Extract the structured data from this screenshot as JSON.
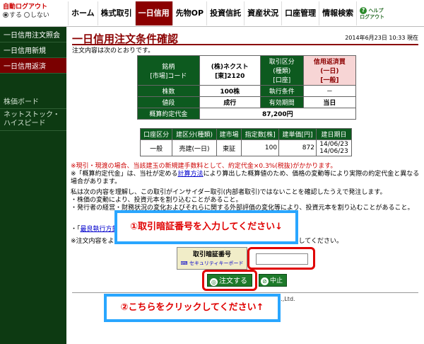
{
  "header": {
    "auto_logout_label": "自動ログアウト",
    "auto_logout_on": "する",
    "auto_logout_off": "しない",
    "nav": [
      "ホーム",
      "株式取引",
      "一日信用",
      "先物OP",
      "投資信託",
      "資産状況",
      "口座管理",
      "情報検索"
    ],
    "help_label": "ヘルプ",
    "logout_label": "ログアウト"
  },
  "sidebar": {
    "items": [
      "一日信用注文照会",
      "一日信用新規",
      "一日信用返済",
      "株価ボード",
      "ネットストック・ハイスピード"
    ]
  },
  "page": {
    "title": "一日信用注文条件確認",
    "timestamp": "2014年6月23日 10:33 現在",
    "intro": "注文内容は次のとおりです。"
  },
  "order": {
    "stock_label_1": "銘柄",
    "stock_label_2": "[市場]コード",
    "stock_name": "(株)ネクスト",
    "stock_market_code": "[東]2120",
    "type_label_1": "取引区分",
    "type_label_2": "(種類)",
    "type_label_3": "[口座]",
    "type_value_1": "信用返済買",
    "type_value_2": "(一日)",
    "type_value_3": "[一般]",
    "qty_label": "株数",
    "qty_value": "100株",
    "exec_label": "執行条件",
    "exec_value": "－",
    "price_label": "値段",
    "price_value": "成行",
    "validity_label": "有効期間",
    "validity_value": "当日",
    "estimate_label": "概算約定代金",
    "estimate_value": "87,200円"
  },
  "exec_table": {
    "headers": [
      "口座区分",
      "建区分(種類)",
      "建市場",
      "指定数[株]",
      "建単価[円]",
      "建日期日"
    ],
    "row": [
      "一般",
      "売建(一日)",
      "東証",
      "100",
      "872",
      "14/06/23",
      "14/06/23"
    ]
  },
  "notes": {
    "line1": "※現引・現渡の場合、当該建玉の新規建手数料として、約定代金×0.3%(税抜)がかかります。",
    "line2_a": "※「概算約定代金」は、当社が定める",
    "line2_link": "計算方法",
    "line2_b": "により算出した概算値のため、価格の変動等により実際の約定代金と異なる場合があります。"
  },
  "para": {
    "line1": "私は次の内容を理解し、この取引がインサイダー取引(内部者取引)ではないことを確認したうえで発注します。",
    "line2": "・株価の変動により、投資元本を割り込むことがあること。",
    "line3": "・発行者の経営・財務状況の変化およびそれらに関する外部評価の変化等により、投資元本を割り込むことがあること。",
    "link_prefix": "・「",
    "link_text": "最良執行方針"
  },
  "confirm_note": "※注文内容をよくご確認のうえ、取引暗証番号を入力し「注文する」ボタンを押してください。",
  "pin": {
    "label": "取引暗証番号",
    "keyboard_link": "セキュリティキーボード",
    "value": ""
  },
  "buttons": {
    "order": "注文する",
    "cancel": "中止"
  },
  "copyright": "Matsui Securities Co.,Ltd.",
  "callouts": {
    "pin": "①取引暗証番号を入力してください↓",
    "click": "②こちらをクリックしてください↑"
  }
}
